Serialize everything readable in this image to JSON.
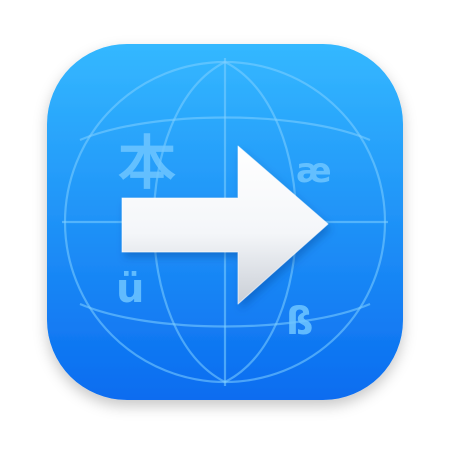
{
  "app_icon": {
    "icon_name": "translate-arrow-globe-icon",
    "colors": {
      "background_top": "#34B8FF",
      "background_bottom": "#0A6CF0",
      "globe_lines": "#7FCFFF",
      "glyph_color": "#6EC6FF",
      "arrow_fill": "#FFFFFF",
      "arrow_shadow": "#C9CED6"
    },
    "glyphs": {
      "cjk": "本",
      "ae": "æ",
      "u_umlaut": "ü",
      "eszett": "ß"
    }
  }
}
